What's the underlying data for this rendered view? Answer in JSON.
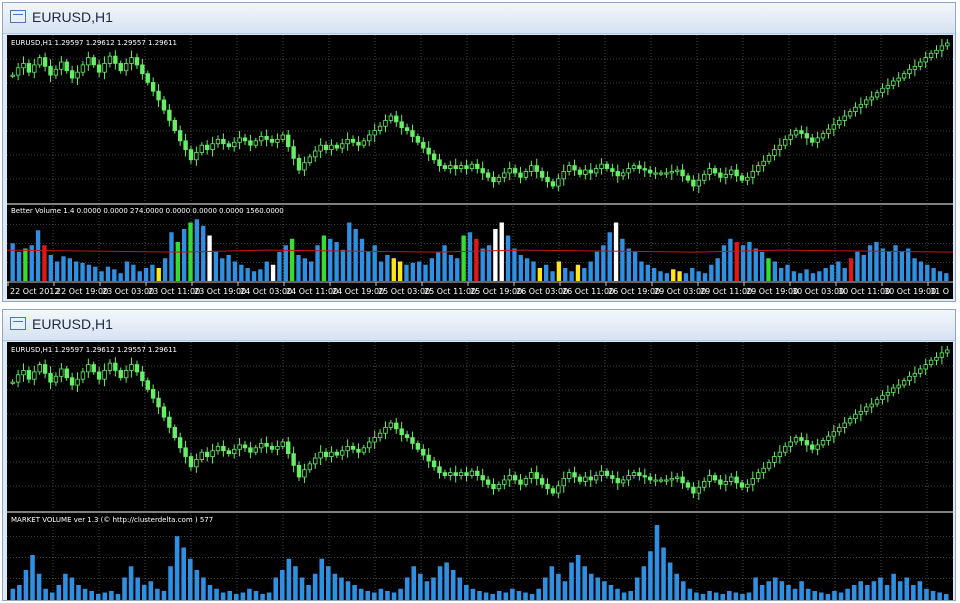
{
  "windows": [
    {
      "title": "EURUSD,H1",
      "price_label": "EURUSD,H1  1.29597 1.29612 1.29557 1.29611",
      "indicator_label": "Better Volume 1.4 0.0000 0.0000 274.0000 0.0000 0.0000 0.0000 1560.0000",
      "time_axis": [
        "22 Oct 2012",
        "22 Oct 19:00",
        "23 Oct 03:00",
        "23 Oct 11:00",
        "23 Oct 19:00",
        "24 Oct 03:00",
        "24 Oct 11:00",
        "24 Oct 19:00",
        "25 Oct 03:00",
        "25 Oct 11:00",
        "25 Oct 19:00",
        "26 Oct 03:00",
        "26 Oct 11:00",
        "26 Oct 19:00",
        "29 Oct 03:00",
        "29 Oct 11:00",
        "29 Oct 19:00",
        "30 Oct 03:00",
        "30 Oct 11:00",
        "30 Oct 19:00",
        "31 O"
      ]
    },
    {
      "title": "EURUSD,H1",
      "price_label": "EURUSD,H1  1.29597 1.29612 1.29557 1.29611",
      "indicator_label": "MARKET VOLUME ver 1.3 (© http://clusterdelta.com ) 577"
    }
  ],
  "colors": {
    "candle": "#66ee66",
    "grid": "#7a7a7a",
    "volume_blue": "#2f8fe0",
    "volume_green": "#33dd33",
    "volume_red": "#e01818",
    "volume_white": "#ffffff",
    "volume_yellow": "#ffe61a",
    "average_line": "#c01818"
  },
  "chart_data": [
    {
      "type": "candlestick",
      "series": [
        {
          "name": "EURUSD,H1",
          "close": [
            0.22,
            0.17,
            0.14,
            0.2,
            0.15,
            0.1,
            0.16,
            0.22,
            0.18,
            0.13,
            0.19,
            0.24,
            0.2,
            0.15,
            0.1,
            0.15,
            0.2,
            0.14,
            0.09,
            0.14,
            0.19,
            0.14,
            0.1,
            0.15,
            0.21,
            0.27,
            0.33,
            0.39,
            0.46,
            0.53,
            0.6,
            0.67,
            0.73,
            0.8,
            0.75,
            0.7,
            0.73,
            0.69,
            0.66,
            0.69,
            0.71,
            0.68,
            0.65,
            0.67,
            0.7,
            0.67,
            0.64,
            0.66,
            0.68,
            0.66,
            0.63,
            0.71,
            0.79,
            0.87,
            0.82,
            0.78,
            0.74,
            0.7,
            0.73,
            0.7,
            0.72,
            0.69,
            0.66,
            0.68,
            0.7,
            0.67,
            0.63,
            0.6,
            0.57,
            0.53,
            0.5,
            0.54,
            0.58,
            0.6,
            0.64,
            0.68,
            0.72,
            0.76,
            0.8,
            0.84,
            0.86,
            0.84,
            0.86,
            0.84,
            0.86,
            0.83,
            0.86,
            0.89,
            0.92,
            0.95,
            0.92,
            0.89,
            0.86,
            0.89,
            0.92,
            0.88,
            0.84,
            0.88,
            0.92,
            0.95,
            0.98,
            0.93,
            0.88,
            0.84,
            0.87,
            0.9,
            0.87,
            0.89,
            0.86,
            0.83,
            0.86,
            0.88,
            0.91,
            0.89,
            0.86,
            0.84,
            0.86,
            0.87,
            0.89,
            0.89,
            0.89,
            0.89,
            0.88,
            0.87,
            0.91,
            0.94,
            0.98,
            0.94,
            0.9,
            0.86,
            0.89,
            0.92,
            0.9,
            0.87,
            0.91,
            0.94,
            0.92,
            0.88,
            0.84,
            0.81,
            0.77,
            0.73,
            0.7,
            0.66,
            0.63,
            0.6,
            0.62,
            0.65,
            0.68,
            0.65,
            0.62,
            0.59,
            0.56,
            0.53,
            0.5,
            0.47,
            0.44,
            0.42,
            0.39,
            0.37,
            0.34,
            0.31,
            0.29,
            0.26,
            0.24,
            0.21,
            0.18,
            0.16,
            0.13,
            0.1,
            0.07,
            0.05,
            0.02,
            0.0
          ]
        }
      ],
      "ylim": [
        1.2918,
        1.3072
      ],
      "yticks": [
        1.3072,
        1.3058,
        1.3044,
        1.303,
        1.3016,
        1.3002,
        1.2988,
        1.2974,
        1.296,
        1.2946,
        1.2932,
        1.2918
      ]
    },
    {
      "type": "bar",
      "series": [
        {
          "name": "Better Volume 1.4",
          "values": [
            0.58,
            0.45,
            0.5,
            0.55,
            0.78,
            0.55,
            0.4,
            0.3,
            0.38,
            0.35,
            0.3,
            0.28,
            0.25,
            0.22,
            0.15,
            0.22,
            0.18,
            0.12,
            0.3,
            0.25,
            0.15,
            0.2,
            0.25,
            0.2,
            0.35,
            0.75,
            0.6,
            0.8,
            0.9,
            0.95,
            0.85,
            0.7,
            0.45,
            0.35,
            0.4,
            0.3,
            0.25,
            0.2,
            0.15,
            0.18,
            0.3,
            0.25,
            0.45,
            0.55,
            0.65,
            0.4,
            0.35,
            0.3,
            0.55,
            0.7,
            0.65,
            0.6,
            0.48,
            0.9,
            0.8,
            0.65,
            0.45,
            0.55,
            0.3,
            0.4,
            0.35,
            0.3,
            0.25,
            0.28,
            0.3,
            0.25,
            0.35,
            0.45,
            0.55,
            0.4,
            0.35,
            0.7,
            0.75,
            0.65,
            0.5,
            0.55,
            0.8,
            0.9,
            0.7,
            0.5,
            0.4,
            0.35,
            0.3,
            0.2,
            0.25,
            0.15,
            0.3,
            0.2,
            0.15,
            0.25,
            0.2,
            0.3,
            0.45,
            0.55,
            0.75,
            0.9,
            0.65,
            0.5,
            0.45,
            0.3,
            0.25,
            0.2,
            0.15,
            0.12,
            0.18,
            0.15,
            0.12,
            0.2,
            0.15,
            0.12,
            0.25,
            0.35,
            0.55,
            0.65,
            0.6,
            0.55,
            0.6,
            0.5,
            0.45,
            0.35,
            0.3,
            0.2,
            0.25,
            0.15,
            0.12,
            0.18,
            0.12,
            0.15,
            0.2,
            0.25,
            0.3,
            0.2,
            0.35,
            0.45,
            0.4,
            0.55,
            0.6,
            0.5,
            0.45,
            0.55,
            0.45,
            0.5,
            0.35,
            0.3,
            0.25,
            0.2,
            0.15,
            0.12
          ]
        },
        {
          "name": "average",
          "values": [
            0.46,
            0.46,
            0.46,
            0.46,
            0.46,
            0.46,
            0.46,
            0.46,
            0.46,
            0.46,
            0.46,
            0.46
          ]
        }
      ]
    },
    {
      "type": "bar",
      "series": [
        {
          "name": "MARKET VOLUME ver 1.3",
          "values": [
            0.15,
            0.2,
            0.4,
            0.6,
            0.35,
            0.15,
            0.1,
            0.2,
            0.35,
            0.3,
            0.2,
            0.15,
            0.12,
            0.08,
            0.1,
            0.12,
            0.08,
            0.3,
            0.45,
            0.3,
            0.2,
            0.25,
            0.15,
            0.12,
            0.45,
            0.85,
            0.7,
            0.55,
            0.4,
            0.3,
            0.2,
            0.15,
            0.1,
            0.12,
            0.08,
            0.1,
            0.15,
            0.12,
            0.08,
            0.1,
            0.3,
            0.4,
            0.55,
            0.45,
            0.3,
            0.2,
            0.35,
            0.55,
            0.45,
            0.35,
            0.3,
            0.25,
            0.2,
            0.15,
            0.12,
            0.1,
            0.15,
            0.12,
            0.1,
            0.15,
            0.3,
            0.45,
            0.35,
            0.25,
            0.3,
            0.45,
            0.5,
            0.4,
            0.3,
            0.2,
            0.15,
            0.12,
            0.1,
            0.08,
            0.12,
            0.1,
            0.15,
            0.12,
            0.1,
            0.08,
            0.15,
            0.3,
            0.45,
            0.35,
            0.25,
            0.5,
            0.6,
            0.45,
            0.35,
            0.3,
            0.25,
            0.2,
            0.15,
            0.1,
            0.12,
            0.3,
            0.45,
            0.65,
            1.0,
            0.7,
            0.5,
            0.35,
            0.25,
            0.15,
            0.1,
            0.08,
            0.12,
            0.1,
            0.08,
            0.12,
            0.1,
            0.08,
            0.1,
            0.3,
            0.2,
            0.25,
            0.3,
            0.25,
            0.2,
            0.15,
            0.25,
            0.15,
            0.12,
            0.1,
            0.08,
            0.12,
            0.1,
            0.15,
            0.2,
            0.25,
            0.2,
            0.25,
            0.3,
            0.2,
            0.35,
            0.25,
            0.3,
            0.2,
            0.25,
            0.15,
            0.12,
            0.1,
            0.08
          ]
        }
      ]
    }
  ]
}
